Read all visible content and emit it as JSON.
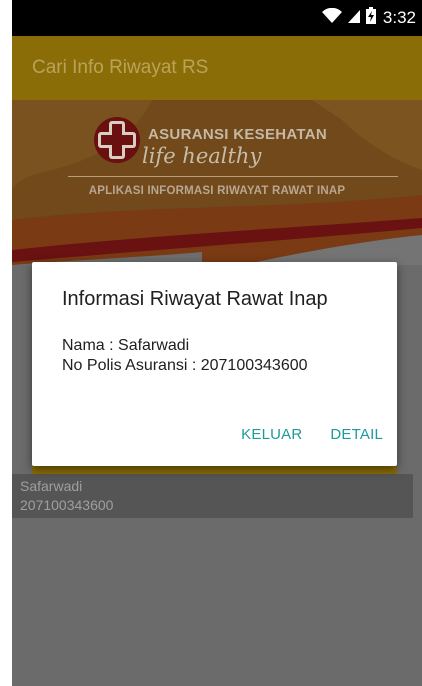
{
  "status_bar": {
    "time": "3:32",
    "icons": [
      "wifi-icon",
      "signal-icon",
      "battery-charging-icon"
    ]
  },
  "app_bar": {
    "title": "Cari Info Riwayat RS"
  },
  "banner": {
    "brand_title": "ASURANSI KESEHATAN",
    "brand_subtitle": "life healthy",
    "caption": "APLIKASI INFORMASI RIWAYAT RAWAT INAP",
    "logo": "red-cross-logo"
  },
  "list_item": {
    "name": "Safarwadi",
    "policy": "207100343600"
  },
  "dialog": {
    "title": "Informasi Riwayat Rawat Inap",
    "name_line": "Nama : Safarwadi",
    "policy_line": "No Polis Asuransi : 207100343600",
    "btn_exit": "KELUAR",
    "btn_detail": "DETAIL"
  },
  "colors": {
    "accent": "#1e9a9a",
    "app_bar": "#8b6d07",
    "scrim": "#6b6b6b"
  }
}
